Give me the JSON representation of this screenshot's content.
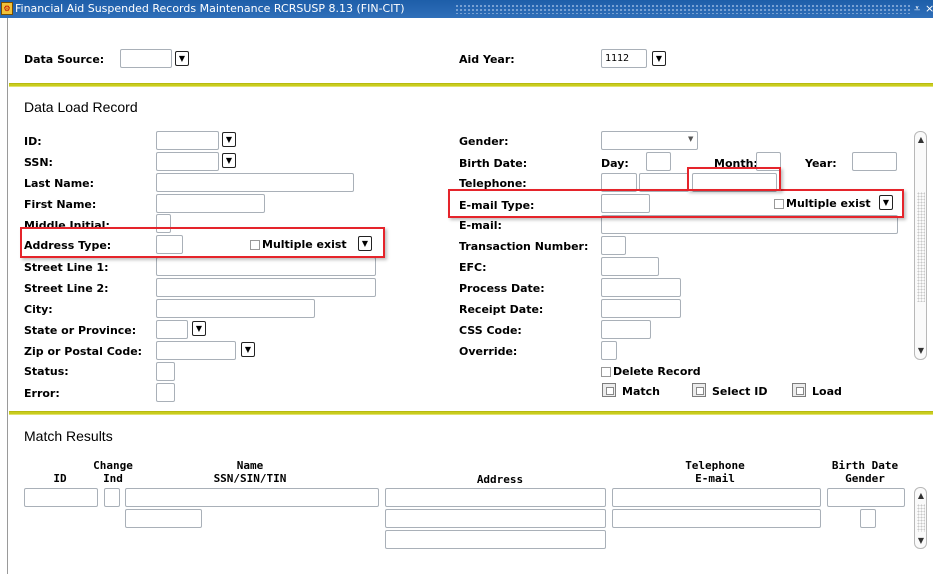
{
  "window": {
    "title": "Financial Aid Suspended Records Maintenance  RCRSUSP  8.13  (FIN-CIT)",
    "app_icon_glyph": "⚙",
    "minimize_glyph": "⩡",
    "close_glyph": "×"
  },
  "key_block": {
    "data_source_label": "Data Source:",
    "data_source_value": "",
    "aid_year_label": "Aid Year:",
    "aid_year_value": "1112"
  },
  "data_load_record": {
    "title": "Data Load Record",
    "left": {
      "id_label": "ID:",
      "ssn_label": "SSN:",
      "last_name_label": "Last Name:",
      "first_name_label": "First Name:",
      "middle_initial_label": "Middle Initial:",
      "address_type_label": "Address Type:",
      "address_multiple_label": "Multiple exist",
      "street1_label": "Street Line 1:",
      "street2_label": "Street Line 2:",
      "city_label": "City:",
      "state_label": "State or Province:",
      "zip_label": "Zip or Postal Code:",
      "status_label": "Status:",
      "error_label": "Error:"
    },
    "right": {
      "gender_label": "Gender:",
      "birth_date_label": "Birth Date:",
      "day_label": "Day:",
      "month_label": "Month:",
      "year_label": "Year:",
      "telephone_label": "Telephone:",
      "email_type_label": "E-mail Type:",
      "email_multiple_label": "Multiple exist",
      "email_label": "E-mail:",
      "transaction_label": "Transaction Number:",
      "efc_label": "EFC:",
      "process_date_label": "Process Date:",
      "receipt_date_label": "Receipt Date:",
      "css_code_label": "CSS Code:",
      "override_label": "Override:",
      "delete_record_label": "Delete Record",
      "match_label": "Match",
      "select_id_label": "Select ID",
      "load_label": "Load"
    }
  },
  "match_results": {
    "title": "Match Results",
    "columns": {
      "id": "ID",
      "change_ind_1": "Change",
      "change_ind_2": "Ind",
      "name_1": "Name",
      "name_2": "SSN/SIN/TIN",
      "address": "Address",
      "telephone_1": "Telephone",
      "telephone_2": "E-mail",
      "birth_date_1": "Birth Date",
      "birth_date_2": "Gender"
    }
  },
  "icons": {
    "dropdown": "▼",
    "scroll_up": "▲",
    "scroll_down": "▼"
  },
  "colors": {
    "titlebar": "#1d5ea9",
    "section_divider": "#c9cc1e",
    "highlight_box": "#e5242b"
  }
}
